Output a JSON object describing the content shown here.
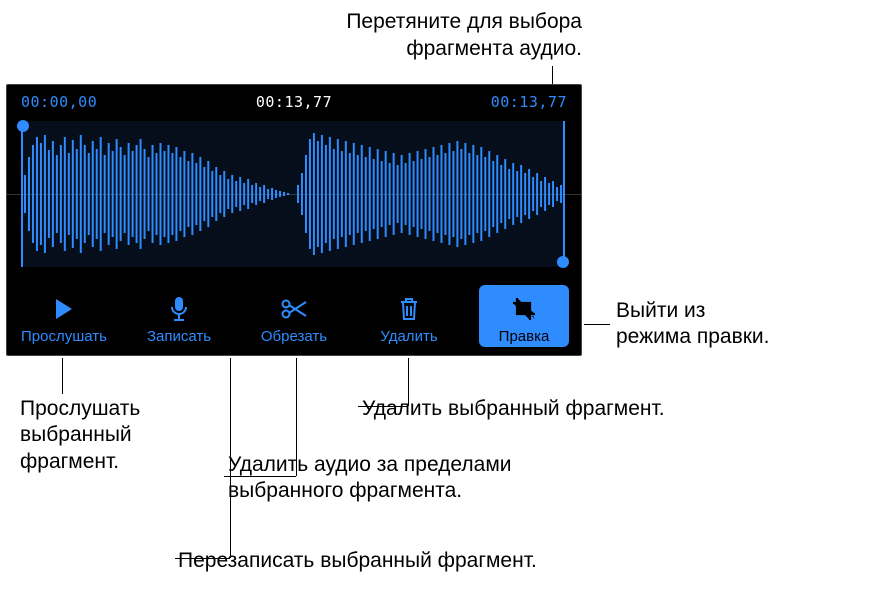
{
  "callouts": {
    "top": "Перетяните для выбора\nфрагмента аудио.",
    "exit": "Выйти из\nрежима правки.",
    "delete": "Удалить выбранный фрагмент.",
    "listen": "Прослушать\nвыбранный\nфрагмент.",
    "trim": "Удалить аудио за пределами\nвыбранного фрагмента.",
    "record": "Перезаписать выбранный фрагмент."
  },
  "times": {
    "start": "00:00,00",
    "current": "00:13,77",
    "end": "00:13,77"
  },
  "toolbar": {
    "play": "Прослушать",
    "record": "Записать",
    "trim": "Обрезать",
    "delete": "Удалить",
    "edit": "Правка"
  }
}
